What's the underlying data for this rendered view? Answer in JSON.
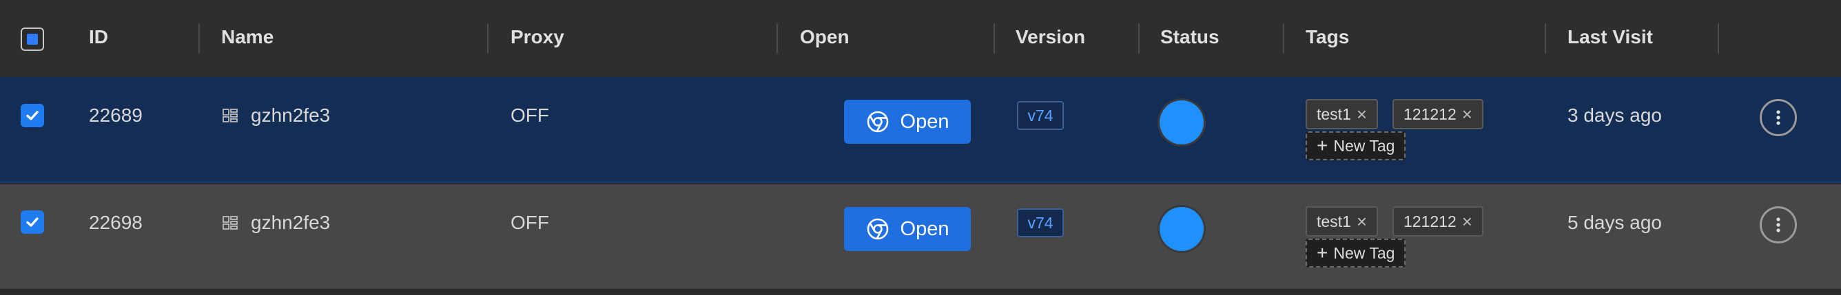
{
  "header": {
    "columns": {
      "id": "ID",
      "name": "Name",
      "proxy": "Proxy",
      "open": "Open",
      "version": "Version",
      "status": "Status",
      "tags": "Tags",
      "last_visit": "Last Visit"
    },
    "select_all_state": "indeterminate"
  },
  "rows": [
    {
      "selected": true,
      "id": "22689",
      "name": "gzhn2fe3",
      "os_icon": "windows-icon",
      "proxy": "OFF",
      "open_label": "Open",
      "browser_icon": "chrome-icon",
      "version": "v74",
      "status_color": "#1e90ff",
      "tags": [
        {
          "label": "test1"
        },
        {
          "label": "121212"
        }
      ],
      "new_tag_label": "New Tag",
      "last_visit": "3 days ago"
    },
    {
      "selected": true,
      "id": "22698",
      "name": "gzhn2fe3",
      "os_icon": "windows-icon",
      "proxy": "OFF",
      "open_label": "Open",
      "browser_icon": "chrome-icon",
      "version": "v74",
      "status_color": "#1e90ff",
      "tags": [
        {
          "label": "test1"
        },
        {
          "label": "121212"
        }
      ],
      "new_tag_label": "New Tag",
      "last_visit": "5 days ago"
    }
  ],
  "colors": {
    "accent": "#1f6fe0",
    "selected_row": "#142d55",
    "row_bg": "#474747",
    "header_bg": "#2e2e2e",
    "version_text": "#5aa2ff"
  }
}
